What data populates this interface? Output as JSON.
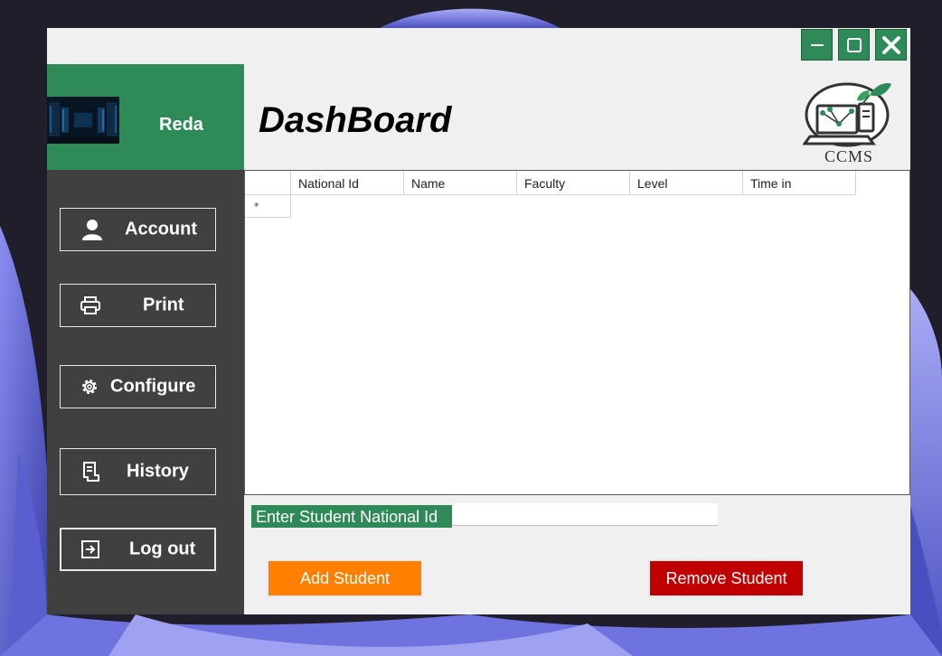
{
  "window": {
    "controls": {
      "minimize": "minimize-icon",
      "maximize": "maximize-icon",
      "close": "close-icon"
    }
  },
  "user": {
    "name": "Reda"
  },
  "nav": {
    "items": [
      {
        "label": "Account",
        "icon": "user-icon"
      },
      {
        "label": "Print",
        "icon": "printer-icon"
      },
      {
        "label": "Configure",
        "icon": "gear-icon"
      },
      {
        "label": "History",
        "icon": "receipt-icon"
      },
      {
        "label": "Log out",
        "icon": "logout-icon"
      }
    ]
  },
  "page": {
    "title": "DashBoard"
  },
  "logo": {
    "text": "CCMS"
  },
  "grid": {
    "columns": [
      "National Id",
      "Name",
      "Faculty",
      "Level",
      "Time in"
    ],
    "new_row_marker": "*",
    "rows": []
  },
  "form": {
    "input_label": "Enter Student National Id",
    "input_value": ""
  },
  "actions": {
    "add_label": "Add Student",
    "remove_label": "Remove Student"
  },
  "colors": {
    "accent_green": "#2e8b57",
    "sidebar": "#404040",
    "add_button": "#ff8000",
    "remove_button": "#c00000"
  }
}
